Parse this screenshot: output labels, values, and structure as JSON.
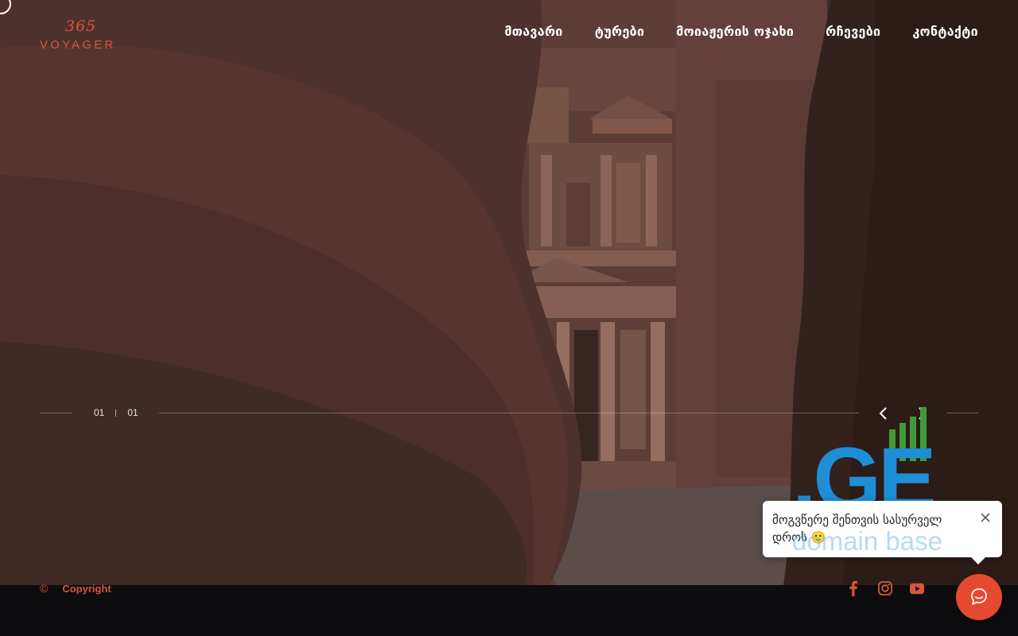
{
  "logo": {
    "mark": "365",
    "word": "VOYAGER"
  },
  "nav": {
    "items": [
      {
        "label": "მთავარი"
      },
      {
        "label": "ტურები"
      },
      {
        "label": "მოიაჟერის ოჯახი"
      },
      {
        "label": "რჩევები"
      },
      {
        "label": "კონტაქტი"
      }
    ]
  },
  "slider": {
    "current": "01",
    "total": "01"
  },
  "watermark": {
    "brand": ".GE",
    "tagline": "domain base"
  },
  "chat": {
    "message": "მოგვწერე შენთვის სასურველ დროს 🙂"
  },
  "footer": {
    "copyright_symbol": "©",
    "copyright_text": "Copyright",
    "socials": [
      "facebook-icon",
      "instagram-icon",
      "youtube-icon"
    ]
  },
  "colors": {
    "accent": "#d8553c",
    "chat_button": "#e5492f",
    "footer_bg": "#0d0d0f"
  }
}
